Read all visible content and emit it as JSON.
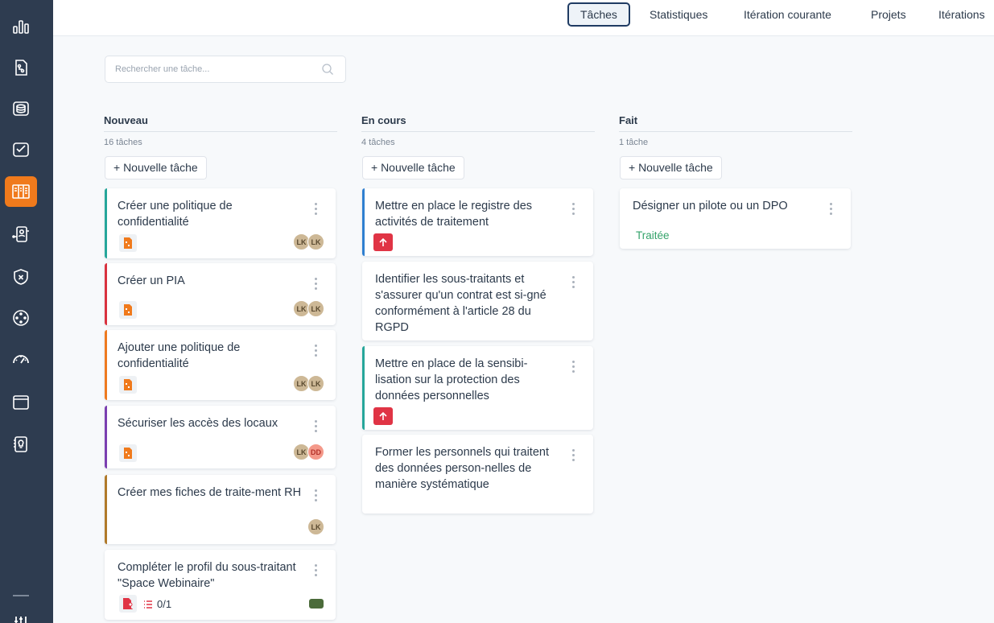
{
  "nav": {
    "tabs": [
      {
        "label": "Tâches",
        "active": true
      },
      {
        "label": "Statistiques"
      },
      {
        "label": "Itération courante"
      },
      {
        "label": "Projets"
      },
      {
        "label": "Itérations"
      }
    ]
  },
  "search": {
    "placeholder": "Rechercher une tâche..."
  },
  "sidebar": {
    "icons": [
      "chart-icon",
      "document-flow-icon",
      "database-icon",
      "checklist-icon",
      "kanban-icon",
      "user-process-icon",
      "shield-icon",
      "dots-circle-icon",
      "gauge-icon",
      "folder-icon",
      "bulb-document-icon",
      "settings-sliders-icon"
    ],
    "active_icon": "kanban-icon",
    "accent": "#f07a1c",
    "background": "#2e3c50"
  },
  "columns": [
    {
      "title": "Nouveau",
      "count": "16 tâches",
      "new_label": "+ Nouvelle tâche",
      "cards": [
        {
          "title": "Créer une politique de confidentialité",
          "color": "#26a69a",
          "avatars": [
            "LK",
            "LK"
          ]
        },
        {
          "title": "Créer un PIA",
          "color": "#d9323f",
          "avatars": [
            "LK",
            "LK"
          ]
        },
        {
          "title": "Ajouter une politique de confidentialité",
          "color": "#ee7a1f",
          "avatars": [
            "LK",
            "LK"
          ]
        },
        {
          "title": "Sécuriser les accès des locaux",
          "color": "#7b3fb0",
          "avatars": [
            "LK",
            "DD"
          ]
        },
        {
          "title": "Créer mes fiches de traite-ment RH",
          "color": "#b07a2a",
          "avatars": [
            "LK"
          ]
        },
        {
          "title": "Compléter le profil du sous-traitant \"Space Webinaire\"",
          "color": "",
          "checklist": "0/1"
        }
      ]
    },
    {
      "title": "En cours",
      "count": "4 tâches",
      "new_label": "+ Nouvelle tâche",
      "cards": [
        {
          "title": "Mettre en place le registre des activités de traitement",
          "color": "#2f7fd0",
          "priority": true
        },
        {
          "title": "Identifier les sous-traitants et s'assurer qu'un contrat est si-gné conformément à l'article 28 du RGPD",
          "color": ""
        },
        {
          "title": "Mettre en place de la sensibi-lisation sur la protection des données personnelles",
          "color": "#26a69a",
          "priority": true
        },
        {
          "title": "Former les personnels qui traitent des données person-nelles de manière systématique",
          "color": ""
        }
      ]
    },
    {
      "title": "Fait",
      "count": "1 tâche",
      "new_label": "+ Nouvelle tâche",
      "cards": [
        {
          "title": "Désigner un pilote ou un DPO",
          "color": "",
          "status": "Traitée"
        }
      ]
    }
  ]
}
